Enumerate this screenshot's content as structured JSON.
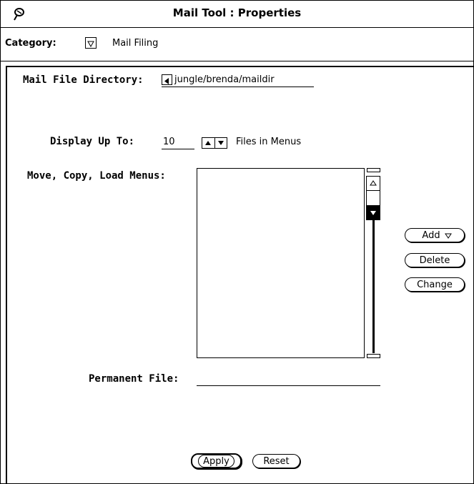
{
  "window": {
    "title": "Mail Tool  : Properties",
    "menu_icon": "window-menu-icon"
  },
  "category": {
    "label": "Category:",
    "menu_icon": "triangle-down-icon",
    "value": "Mail Filing"
  },
  "mail_file_directory": {
    "label": "Mail File Directory:",
    "scroll_icon": "scroll-left-icon",
    "value": "jungle/brenda/maildir"
  },
  "display_up_to": {
    "label": "Display Up To:",
    "value": "10",
    "stepper_icon": "up-down-stepper-icon",
    "suffix": "Files in Menus"
  },
  "menus": {
    "label": "Move, Copy, Load Menus:",
    "items": [],
    "buttons": {
      "add": "Add",
      "add_icon": "triangle-down-icon",
      "delete": "Delete",
      "change": "Change"
    }
  },
  "permanent_file": {
    "label": "Permanent File:",
    "value": ""
  },
  "footer": {
    "apply": "Apply",
    "reset": "Reset"
  }
}
